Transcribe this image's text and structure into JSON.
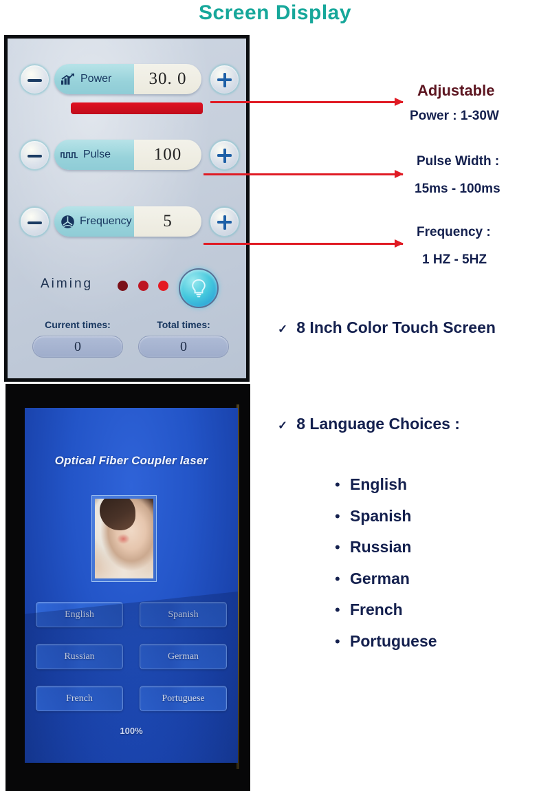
{
  "page": {
    "title": "Screen Display",
    "title_color": "#16a79a"
  },
  "top_screen": {
    "controls": [
      {
        "icon": "bar-chart-up-icon",
        "label": "Power",
        "value": "30. 0",
        "minus": "−",
        "plus": "+"
      },
      {
        "icon": "square-wave-icon",
        "label": "Pulse",
        "value": "100",
        "minus": "−",
        "plus": "+"
      },
      {
        "icon": "frequency-fan-icon",
        "label": "Frequency",
        "value": "5",
        "minus": "−",
        "plus": "+"
      }
    ],
    "power_bar": {
      "fill_percent": 100,
      "color": "#d01020"
    },
    "aiming": {
      "label": "Aiming",
      "dot_colors": [
        "#7a1018",
        "#bd1522",
        "#e51a22"
      ],
      "light_button_icon": "light-bulb-icon"
    },
    "counters": [
      {
        "label": "Current times:",
        "value": "0"
      },
      {
        "label": "Total times:",
        "value": "0"
      }
    ]
  },
  "annotations": {
    "adjustable_heading": "Adjustable",
    "adjustable_heading_color": "#5c1520",
    "power_range": "Power : 1-30W",
    "pulse_title": "Pulse Width :",
    "pulse_range": "15ms - 100ms",
    "frequency_title": "Frequency :",
    "frequency_range": "1 HZ - 5HZ",
    "text_color": "#14204e",
    "arrow_color": "#e01b24"
  },
  "features": {
    "check_mark": "✓",
    "touch_screen": "8 Inch Color Touch Screen",
    "language_choices": "8 Language Choices  :",
    "bullet": "•",
    "languages": [
      "English",
      "Spanish",
      "Russian",
      "German",
      "French",
      "Portuguese"
    ]
  },
  "bottom_screen": {
    "title": "Optical Fiber Coupler laser",
    "photo_alt": "woman-portrait-photo",
    "language_buttons": [
      "English",
      "Spanish",
      "Russian",
      "German",
      "French",
      "Portuguese"
    ],
    "progress": "100%"
  }
}
